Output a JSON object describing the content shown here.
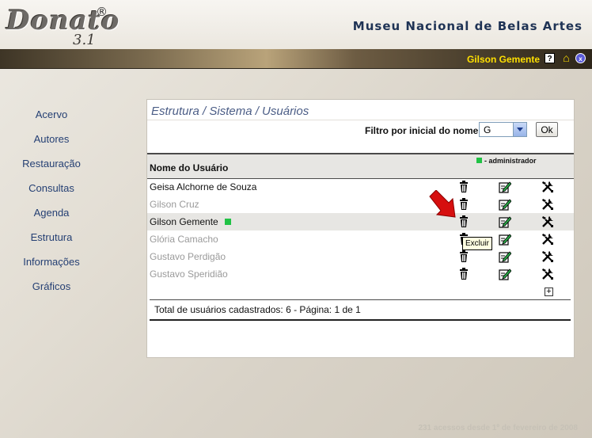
{
  "header": {
    "logo_text": "Donato",
    "logo_registered": "®",
    "logo_version": "3.1",
    "museum_title": "Museu Nacional de Belas Artes"
  },
  "userbar": {
    "username": "Gilson Gemente",
    "help_icon": "?",
    "home_icon": "home-icon",
    "close_icon": "x"
  },
  "sidebar": {
    "items": [
      {
        "label": "Acervo"
      },
      {
        "label": "Autores"
      },
      {
        "label": "Restauração"
      },
      {
        "label": "Consultas"
      },
      {
        "label": "Agenda"
      },
      {
        "label": "Estrutura"
      },
      {
        "label": "Informações"
      },
      {
        "label": "Gráficos"
      }
    ]
  },
  "panel": {
    "breadcrumb": "Estrutura / Sistema / Usuários",
    "filter_label": "Filtro por inicial do nome:",
    "filter_value": "G",
    "ok_label": "Ok",
    "column_header": "Nome do Usuário",
    "legend_label": "- administrador",
    "legend_color": "#21c245",
    "users": [
      {
        "name": "Geisa Alchorne de Souza",
        "active": true,
        "admin": false
      },
      {
        "name": "Gilson Cruz",
        "active": false,
        "admin": false
      },
      {
        "name": "Gilson Gemente",
        "active": true,
        "admin": true
      },
      {
        "name": "Glória Camacho",
        "active": false,
        "admin": false
      },
      {
        "name": "Gustavo Perdigão",
        "active": false,
        "admin": false
      },
      {
        "name": "Gustavo Speridião",
        "active": false,
        "admin": false
      }
    ],
    "add_label": "+",
    "total_text": "Total de usuários cadastrados: 6 - Página: 1 de 1"
  },
  "tooltip": {
    "text": "Excluir"
  },
  "footer": {
    "text": "231 acessos desde 1º de fevereiro de 2008"
  },
  "colors": {
    "accent": "#243f73",
    "username": "#ffe000",
    "row_highlight": "#e7e6e3"
  }
}
